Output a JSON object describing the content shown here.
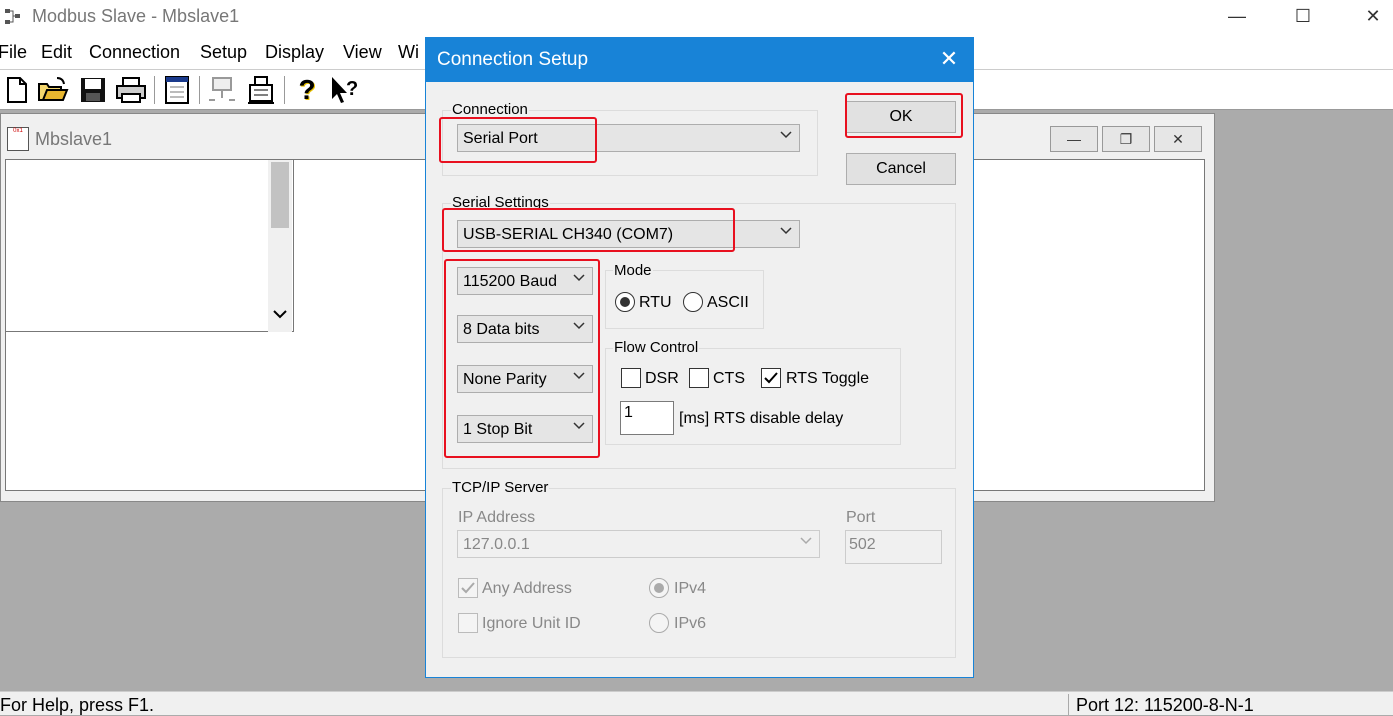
{
  "app": {
    "title": "Modbus Slave - Mbslave1",
    "window_controls": {
      "minimize": "—",
      "maximize": "☐",
      "close": "✕"
    }
  },
  "menu": [
    "File",
    "Edit",
    "Connection",
    "Setup",
    "Display",
    "View",
    "Wi"
  ],
  "toolbar": {
    "icons": [
      "new-document-icon",
      "open-folder-icon",
      "save-icon",
      "print-icon",
      "window-icon",
      "connect-icon",
      "disconnect-icon",
      "help-icon",
      "context-help-icon"
    ]
  },
  "child_window": {
    "title": "Mbslave1",
    "icon_text": "0x1",
    "controls": {
      "minimize": "—",
      "restore": "❐",
      "close": "✕"
    }
  },
  "status": {
    "left": "For Help, press F1.",
    "right": "Port 12: 115200-8-N-1"
  },
  "dialog": {
    "title": "Connection Setup",
    "close": "✕",
    "ok_label": "OK",
    "cancel_label": "Cancel",
    "connection": {
      "label": "Connection",
      "value": "Serial Port"
    },
    "serial": {
      "label": "Serial Settings",
      "port": "USB-SERIAL CH340 (COM7)",
      "baud": "115200 Baud",
      "data_bits": "8 Data bits",
      "parity": "None Parity",
      "stop_bits": "1 Stop Bit"
    },
    "mode": {
      "label": "Mode",
      "rtu": "RTU",
      "ascii": "ASCII",
      "selected": "RTU"
    },
    "flow": {
      "label": "Flow Control",
      "dsr": "DSR",
      "cts": "CTS",
      "rts": "RTS Toggle",
      "dsr_checked": false,
      "cts_checked": false,
      "rts_checked": true,
      "delay_value": "1",
      "delay_label": "[ms] RTS disable delay"
    },
    "tcp": {
      "label": "TCP/IP Server",
      "ip_label": "IP Address",
      "ip_value": "127.0.0.1",
      "port_label": "Port",
      "port_value": "502",
      "any_address": "Any Address",
      "ignore_unit": "Ignore Unit ID",
      "ipv4": "IPv4",
      "ipv6": "IPv6"
    }
  },
  "colors": {
    "dialog_title": "#1883d7",
    "highlight": "#e8101f",
    "workspace": "#ababab"
  }
}
